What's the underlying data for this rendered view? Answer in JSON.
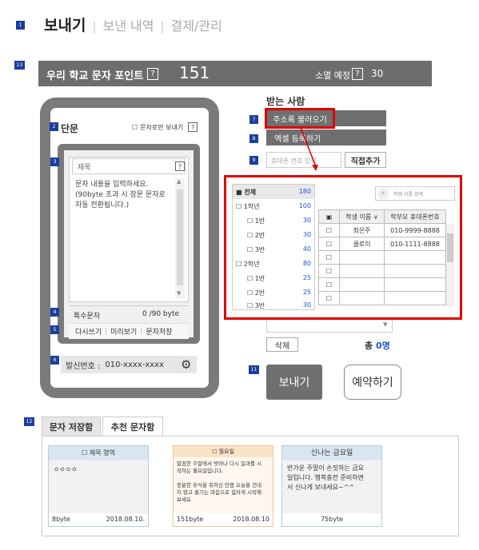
{
  "top_tabs": {
    "send": "보내기",
    "sent": "보낸 내역",
    "payment": "결제/관리",
    "sep": "|"
  },
  "header": {
    "title": "우리 학교 문자 포인트",
    "q": "?",
    "points": "151",
    "expected_label": "소멸 예정",
    "expected_value": "30"
  },
  "markers": {
    "m1": "1",
    "m2": "2",
    "m3": "3",
    "m4": "4",
    "m5": "5",
    "m6": "6",
    "m7": "7",
    "m8": "8",
    "m9": "9",
    "m11": "11",
    "m12": "12",
    "m13": "13"
  },
  "phone": {
    "type_label": "단문",
    "sms_only_label": "문자로만 보내기",
    "q": "?",
    "title_placeholder": "제목",
    "body_placeholder": "문자 내용을 입력하세요.\n(90byte 초과 시 장문 문자로 자동 전환됩니다.)",
    "special_chars": "특수문자",
    "byte_count": "0 /90 byte",
    "rewrite": "다시쓰기",
    "preview": "미리보기",
    "save": "문자저장",
    "sender_label": "발신번호 :",
    "sender_number": "010-xxxx-xxxx"
  },
  "recipients": {
    "title": "받는 사람",
    "address_book": "주소록 불러오기",
    "excel_upload": "엑셀 등록하기",
    "direct_placeholder": "휴대폰 번호 입력",
    "direct_add": "직접추가",
    "delete": "삭제",
    "total_label": "총",
    "total_value": "0명"
  },
  "tree": [
    {
      "label": "전체",
      "count": "180",
      "check": "■"
    },
    {
      "label": "1학년",
      "count": "100",
      "check": "☐"
    },
    {
      "label": "1반",
      "count": "30",
      "check": "☐"
    },
    {
      "label": "2반",
      "count": "30",
      "check": "☐"
    },
    {
      "label": "3반",
      "count": "40",
      "check": "☐"
    },
    {
      "label": "2학년",
      "count": "80",
      "check": "☐"
    },
    {
      "label": "1반",
      "count": "25",
      "check": "☐"
    },
    {
      "label": "2반",
      "count": "25",
      "check": "☐"
    },
    {
      "label": "3반",
      "count": "30",
      "check": "☐"
    }
  ],
  "student_search_placeholder": "학생 이름 검색",
  "student_table": {
    "head_check": "▣",
    "col_name": "학생 이름 ∨",
    "col_phone": "학부모 휴대폰번호",
    "rows": [
      {
        "check": "☐",
        "name": "최은주",
        "phone": "010-9999-8888"
      },
      {
        "check": "☐",
        "name": "클로이",
        "phone": "010-1111-8888"
      },
      {
        "check": "☐",
        "name": "",
        "phone": ""
      },
      {
        "check": "☐",
        "name": "",
        "phone": ""
      },
      {
        "check": "☐",
        "name": "",
        "phone": ""
      },
      {
        "check": "☐",
        "name": "",
        "phone": ""
      }
    ]
  },
  "actions": {
    "send": "보내기",
    "reserve": "예약하기"
  },
  "bottom": {
    "tab_saved": "문자 저장함",
    "tab_recommended": "추천 문자함",
    "cards": [
      {
        "header": "☐ 제목 영역",
        "body": "ㅇㅇㅇㅇ",
        "bytes": "8byte",
        "date": "2018.08.10."
      },
      {
        "header": "☐ 월요일",
        "body": "말끔한 주말에서 벗어나 다시 일과를 시작하는 월요일입니다.\n\n충분한 휴식을 취하신 만큼 오늘을 건네지 않고 즐기는 마음으로 힘차게 시작해보세요",
        "bytes": "151byte",
        "date": "2018.08.10"
      },
      {
        "header": "신나는 금요일",
        "body": "반가운 주말이 손짓하는 금요일입니다. 행복충전 준비하면서 신나게 보내세요~^^",
        "bytes": "75byte",
        "date": ""
      }
    ]
  },
  "colors": {
    "accent_red": "#e00000",
    "marker_blue": "#1c3f9e",
    "total_blue": "#2255cc",
    "dark_gray": "#6d6d6d"
  }
}
